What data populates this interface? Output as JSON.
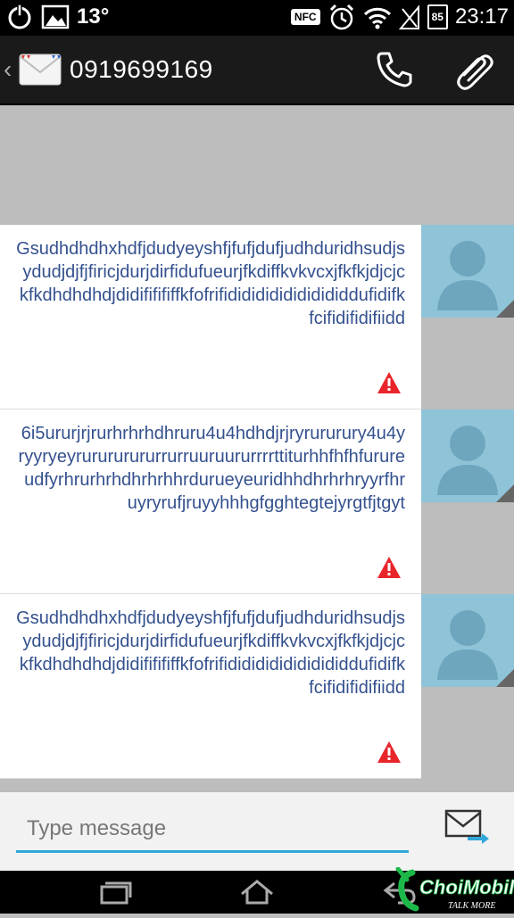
{
  "status_bar": {
    "temperature": "13°",
    "nfc_label": "NFC",
    "battery_level": "85",
    "time": "23:17"
  },
  "action_bar": {
    "back_symbol": "‹",
    "phone_number": "0919699169"
  },
  "messages": [
    {
      "text": "Gsudhdhdhxhdfjdudyeyshfjfufjdufjudhduridhsudjsydudjdjfjfiricjdurjdirfidufueurjfkdiffkvkvcxjfkfkjdjcjckfkdhdhdhdjdidififififfkfofrifidididididididididdufidifkfcifidifidifiidd",
      "status": "failed"
    },
    {
      "text": "6i5ururjrjrurhrhrhdhruru4u4hdhdjrjryrururury4u4yryyryeyrurururururrurruuruururrrrttiturhhfhfhfurureudfyrhrurhrhdhrhrhhrdurueyeuridhhdhrhrhryyrfhruyryrufjruyyhhhgfgghtegtejyrgtfjtgyt",
      "status": "failed"
    },
    {
      "text": "Gsudhdhdhxhdfjdudyeyshfjfufjdufjudhduridhsudjsydudjdjfjfiricjdurjdirfidufueurjfkdiffkvkvcxjfkfkjdjcjckfkdhdhdhdjdidififififfkfofrifidididididididididdufidifkfcifidifidifiidd",
      "status": "failed"
    }
  ],
  "compose": {
    "placeholder": "Type message",
    "value": ""
  },
  "watermark": {
    "brand": "ChoiMobile",
    "tagline": "TALK MORE"
  },
  "colors": {
    "accent": "#2fa7d8",
    "message_text": "#34518e",
    "warning": "#e8252b",
    "avatar_bg": "#8fc4d8"
  },
  "icons": {
    "power": "power-icon",
    "gallery": "gallery-icon",
    "alarm": "alarm-icon",
    "wifi": "wifi-icon",
    "signal": "signal-icon",
    "call": "phone-icon",
    "attach": "paperclip-icon",
    "send": "send-mail-icon",
    "recents": "recent-apps-icon",
    "home": "home-icon",
    "back": "back-icon"
  }
}
